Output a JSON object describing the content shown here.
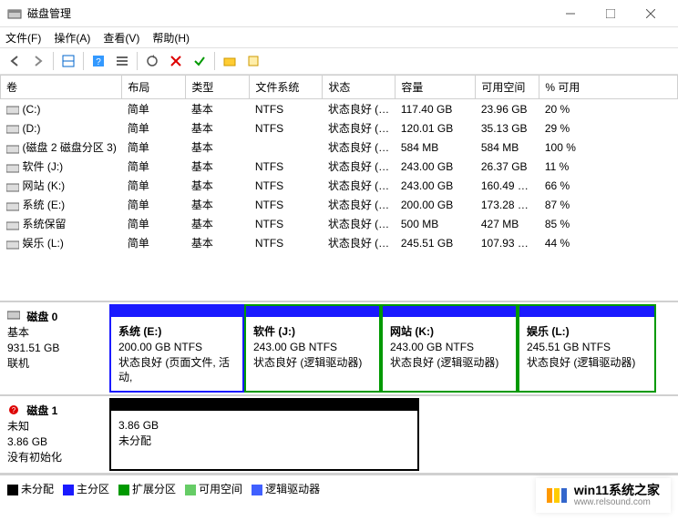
{
  "window": {
    "title": "磁盘管理"
  },
  "menu": {
    "file": "文件(F)",
    "action": "操作(A)",
    "view": "查看(V)",
    "help": "帮助(H)"
  },
  "columns": {
    "vol": "卷",
    "layout": "布局",
    "type": "类型",
    "fs": "文件系统",
    "status": "状态",
    "capacity": "容量",
    "free": "可用空间",
    "pct": "% 可用"
  },
  "volumes": [
    {
      "name": "(C:)",
      "layout": "简单",
      "type": "基本",
      "fs": "NTFS",
      "status": "状态良好 (…",
      "capacity": "117.40 GB",
      "free": "23.96 GB",
      "pct": "20 %"
    },
    {
      "name": "(D:)",
      "layout": "简单",
      "type": "基本",
      "fs": "NTFS",
      "status": "状态良好 (…",
      "capacity": "120.01 GB",
      "free": "35.13 GB",
      "pct": "29 %"
    },
    {
      "name": "(磁盘 2 磁盘分区 3)",
      "layout": "简单",
      "type": "基本",
      "fs": "",
      "status": "状态良好 (…",
      "capacity": "584 MB",
      "free": "584 MB",
      "pct": "100 %"
    },
    {
      "name": "软件 (J:)",
      "layout": "简单",
      "type": "基本",
      "fs": "NTFS",
      "status": "状态良好 (…",
      "capacity": "243.00 GB",
      "free": "26.37 GB",
      "pct": "11 %"
    },
    {
      "name": "网站 (K:)",
      "layout": "简单",
      "type": "基本",
      "fs": "NTFS",
      "status": "状态良好 (…",
      "capacity": "243.00 GB",
      "free": "160.49 …",
      "pct": "66 %"
    },
    {
      "name": "系统 (E:)",
      "layout": "简单",
      "type": "基本",
      "fs": "NTFS",
      "status": "状态良好 (…",
      "capacity": "200.00 GB",
      "free": "173.28 …",
      "pct": "87 %"
    },
    {
      "name": "系统保留",
      "layout": "简单",
      "type": "基本",
      "fs": "NTFS",
      "status": "状态良好 (…",
      "capacity": "500 MB",
      "free": "427 MB",
      "pct": "85 %"
    },
    {
      "name": "娱乐 (L:)",
      "layout": "简单",
      "type": "基本",
      "fs": "NTFS",
      "status": "状态良好 (…",
      "capacity": "245.51 GB",
      "free": "107.93 …",
      "pct": "44 %"
    }
  ],
  "disk0": {
    "name": "磁盘 0",
    "type": "基本",
    "size": "931.51 GB",
    "status": "联机",
    "parts": [
      {
        "name": "系统 (E:)",
        "size": "200.00 GB NTFS",
        "status": "状态良好 (页面文件, 活动,",
        "stripe": "#1a1aff",
        "border": "#1a1aff"
      },
      {
        "name": "软件 (J:)",
        "size": "243.00 GB NTFS",
        "status": "状态良好 (逻辑驱动器)",
        "stripe": "#1a1aff",
        "border": "#009900"
      },
      {
        "name": "网站 (K:)",
        "size": "243.00 GB NTFS",
        "status": "状态良好 (逻辑驱动器)",
        "stripe": "#1a1aff",
        "border": "#009900"
      },
      {
        "name": "娱乐 (L:)",
        "size": "245.51 GB NTFS",
        "status": "状态良好 (逻辑驱动器)",
        "stripe": "#1a1aff",
        "border": "#009900"
      }
    ]
  },
  "disk1": {
    "name": "磁盘 1",
    "type": "未知",
    "size": "3.86 GB",
    "status": "没有初始化",
    "parts": [
      {
        "name": "",
        "size": "3.86 GB",
        "status": "未分配",
        "stripe": "#000000",
        "border": "#000000"
      }
    ]
  },
  "legend": {
    "unalloc": "未分配",
    "primary": "主分区",
    "extended": "扩展分区",
    "freespace": "可用空间",
    "logical": "逻辑驱动器"
  },
  "colors": {
    "unalloc": "#000000",
    "primary": "#1a1aff",
    "extended": "#009900",
    "freespace": "#66cc66",
    "logical": "#4060ff"
  },
  "watermark": {
    "title": "win11系统之家",
    "url": "www.relsound.com"
  }
}
